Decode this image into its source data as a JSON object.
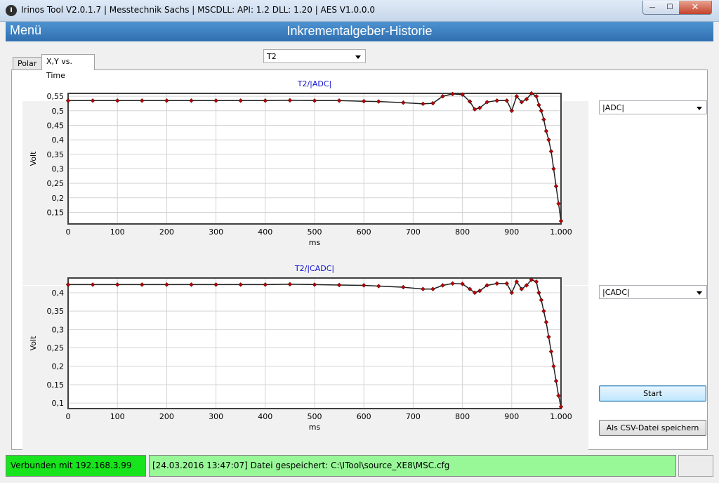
{
  "window": {
    "title": "Irinos Tool V2.0.1.7 | Messtechnik Sachs | MSCDLL: API: 1.2 DLL: 1.20 | AES V1.0.0.0",
    "minimize": "—",
    "maximize": "☐",
    "close": "✕"
  },
  "header": {
    "menu": "Menü",
    "title": "Inkrementalgeber-Historie"
  },
  "tabs": [
    {
      "label": "Polar"
    },
    {
      "label": "X,Y vs. Time"
    }
  ],
  "channel_select": {
    "value": "T2"
  },
  "chart_selects": [
    {
      "value": "|ADC|"
    },
    {
      "value": "|CADC|"
    }
  ],
  "buttons": {
    "start": "Start",
    "save_csv": "Als CSV-Datei speichern"
  },
  "status": {
    "connection": "Verbunden mit 192.168.3.99",
    "message": "[24.03.2016 13:47:07] Datei gespeichert: C:\\ITool\\source_XE8\\MSC.cfg"
  },
  "colors": {
    "accent": "#3a80c4",
    "connected": "#18e41d",
    "status_bg": "#98f898",
    "marker": "#c00000"
  },
  "chart_data": [
    {
      "type": "scatter",
      "title": "T2/|ADC|",
      "xlabel": "ms",
      "ylabel": "Volt",
      "xlim": [
        0,
        1000
      ],
      "ylim": [
        0.11,
        0.56
      ],
      "xticks": [
        "0",
        "100",
        "200",
        "300",
        "400",
        "500",
        "600",
        "700",
        "800",
        "900",
        "1.000"
      ],
      "yticks": [
        "0,55",
        "0,5",
        "0,45",
        "0,4",
        "0,35",
        "0,3",
        "0,25",
        "0,2",
        "0,15"
      ],
      "ytick_values": [
        0.55,
        0.5,
        0.45,
        0.4,
        0.35,
        0.3,
        0.25,
        0.2,
        0.15
      ],
      "grid": true,
      "series": [
        {
          "x": [
            0,
            50,
            100,
            150,
            200,
            250,
            300,
            350,
            400,
            450,
            500,
            550,
            600,
            630,
            680,
            720,
            740,
            760,
            780,
            800,
            815,
            825,
            835,
            850,
            870,
            890,
            900,
            910,
            920,
            930,
            940,
            950,
            955,
            960,
            965,
            970,
            975,
            980,
            985,
            990,
            995,
            1000
          ],
          "y": [
            0.535,
            0.535,
            0.535,
            0.535,
            0.535,
            0.535,
            0.535,
            0.535,
            0.535,
            0.536,
            0.535,
            0.535,
            0.533,
            0.532,
            0.528,
            0.524,
            0.526,
            0.55,
            0.558,
            0.556,
            0.532,
            0.505,
            0.51,
            0.53,
            0.535,
            0.535,
            0.5,
            0.55,
            0.53,
            0.54,
            0.56,
            0.55,
            0.52,
            0.5,
            0.47,
            0.43,
            0.4,
            0.36,
            0.3,
            0.24,
            0.18,
            0.12
          ]
        }
      ]
    },
    {
      "type": "scatter",
      "title": "T2/|CADC|",
      "xlabel": "ms",
      "ylabel": "Volt",
      "xlim": [
        0,
        1000
      ],
      "ylim": [
        0.085,
        0.44
      ],
      "xticks": [
        "0",
        "100",
        "200",
        "300",
        "400",
        "500",
        "600",
        "700",
        "800",
        "900",
        "1.000"
      ],
      "yticks": [
        "0,4",
        "0,35",
        "0,3",
        "0,25",
        "0,2",
        "0,15",
        "0,1"
      ],
      "ytick_values": [
        0.4,
        0.35,
        0.3,
        0.25,
        0.2,
        0.15,
        0.1
      ],
      "grid": true,
      "series": [
        {
          "x": [
            0,
            50,
            100,
            150,
            200,
            250,
            300,
            350,
            400,
            450,
            500,
            550,
            600,
            630,
            680,
            720,
            740,
            760,
            780,
            800,
            815,
            825,
            835,
            850,
            870,
            890,
            900,
            910,
            920,
            930,
            940,
            950,
            955,
            960,
            965,
            970,
            975,
            980,
            985,
            990,
            995,
            1000
          ],
          "y": [
            0.422,
            0.422,
            0.422,
            0.422,
            0.422,
            0.422,
            0.422,
            0.422,
            0.422,
            0.423,
            0.422,
            0.421,
            0.42,
            0.418,
            0.415,
            0.41,
            0.41,
            0.42,
            0.425,
            0.424,
            0.41,
            0.4,
            0.405,
            0.42,
            0.425,
            0.425,
            0.4,
            0.43,
            0.41,
            0.42,
            0.435,
            0.43,
            0.4,
            0.38,
            0.35,
            0.32,
            0.28,
            0.24,
            0.2,
            0.16,
            0.12,
            0.09
          ]
        }
      ]
    }
  ]
}
